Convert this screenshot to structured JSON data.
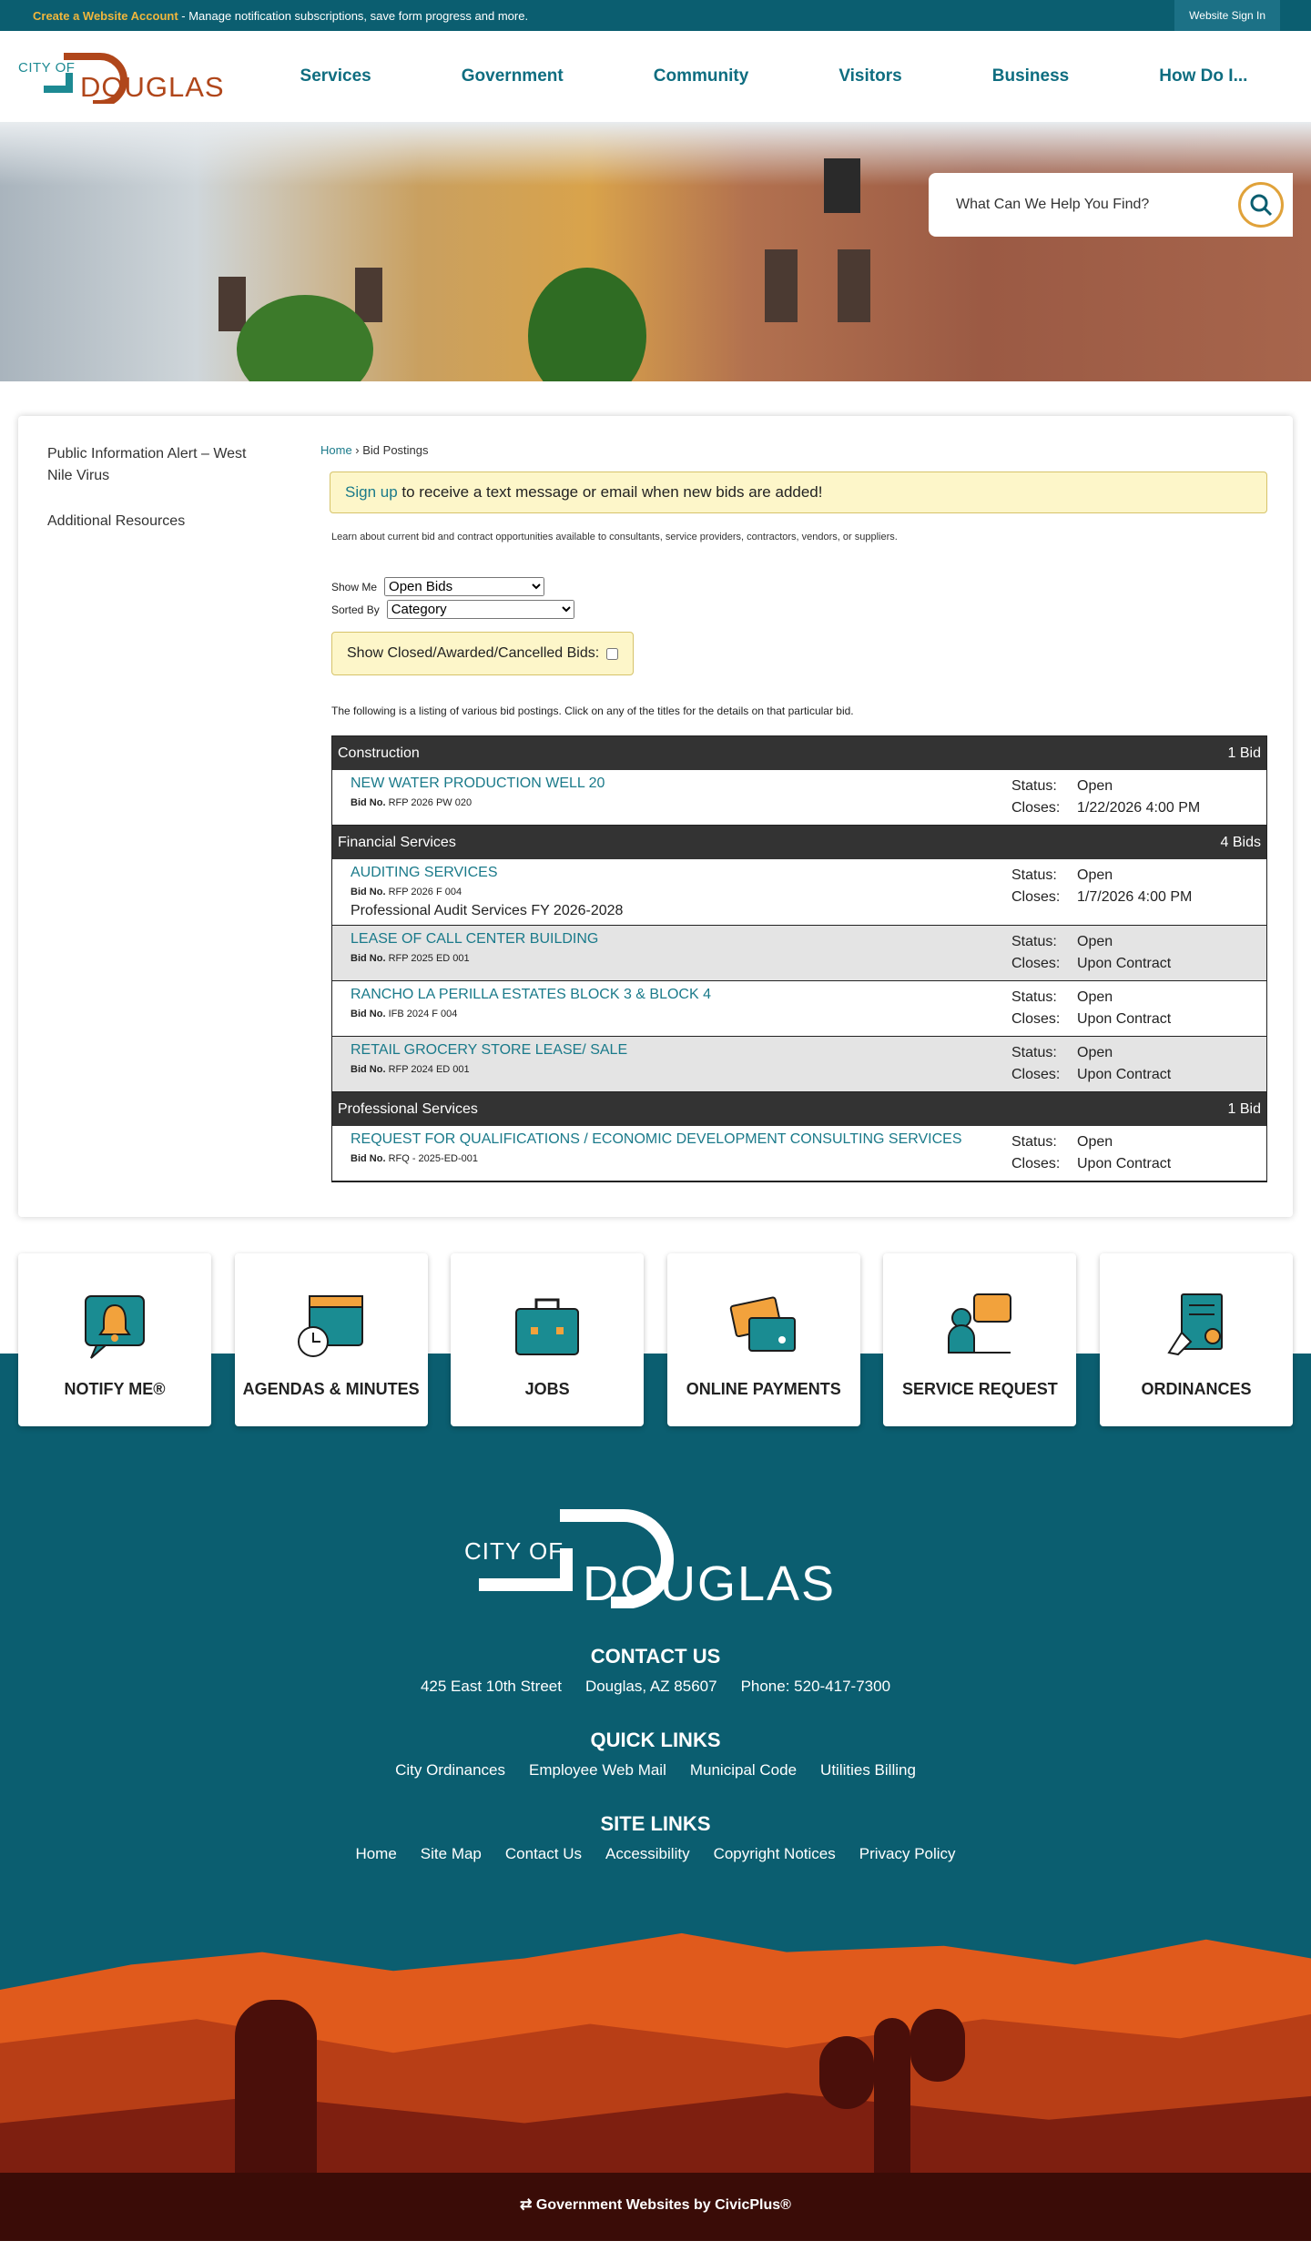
{
  "topbar": {
    "create_link": "Create a Website Account",
    "create_text": " - Manage notification subscriptions, save form progress and more.",
    "signin": "Website Sign In"
  },
  "logo": {
    "cityof": "CITY OF",
    "name": "DOUGLAS"
  },
  "nav": [
    "Services",
    "Government",
    "Community",
    "Visitors",
    "Business",
    "How Do I..."
  ],
  "search": {
    "placeholder": "What Can We Help You Find?"
  },
  "sidebar": [
    "Public Information Alert – West Nile Virus",
    "Additional Resources"
  ],
  "breadcrumb": {
    "home": "Home",
    "current": "Bid Postings"
  },
  "signup": {
    "link": "Sign up",
    "text": " to receive a text message or email when new bids are added!"
  },
  "intro": "Learn about current bid and contract opportunities available to consultants, service providers, contractors, vendors, or suppliers.",
  "filters": {
    "show_me_label": "Show Me",
    "show_me_value": "Open Bids",
    "sorted_by_label": "Sorted By",
    "sorted_by_value": "Category",
    "closed_label": "Show Closed/Awarded/Cancelled Bids:"
  },
  "listing_note": "The following is a listing of various bid postings. Click on any of the titles for the details on that particular bid.",
  "labels": {
    "bid_no": "Bid No.",
    "status": "Status:",
    "closes": "Closes:"
  },
  "categories": [
    {
      "name": "Construction",
      "count": "1 Bid",
      "bids": [
        {
          "title": "NEW WATER PRODUCTION WELL 20",
          "bid_no": "RFP 2026 PW 020",
          "desc": "",
          "status": "Open",
          "closes": "1/22/2026 4:00 PM"
        }
      ]
    },
    {
      "name": "Financial Services",
      "count": "4 Bids",
      "bids": [
        {
          "title": "AUDITING SERVICES",
          "bid_no": "RFP 2026 F 004",
          "desc": "Professional Audit Services FY 2026-2028",
          "status": "Open",
          "closes": "1/7/2026 4:00 PM"
        },
        {
          "title": "LEASE OF CALL CENTER BUILDING",
          "bid_no": "RFP 2025 ED 001",
          "desc": "",
          "status": "Open",
          "closes": "Upon Contract"
        },
        {
          "title": "RANCHO LA PERILLA ESTATES BLOCK 3 & BLOCK 4",
          "bid_no": "IFB 2024 F 004",
          "desc": "",
          "status": "Open",
          "closes": "Upon Contract"
        },
        {
          "title": "RETAIL GROCERY STORE LEASE/ SALE",
          "bid_no": "RFP 2024 ED 001",
          "desc": "",
          "status": "Open",
          "closes": "Upon Contract"
        }
      ]
    },
    {
      "name": "Professional Services",
      "count": "1 Bid",
      "bids": [
        {
          "title": "REQUEST FOR QUALIFICATIONS / ECONOMIC DEVELOPMENT CONSULTING SERVICES",
          "bid_no": "RFQ - 2025-ED-001",
          "desc": "",
          "status": "Open",
          "closes": "Upon Contract"
        }
      ]
    }
  ],
  "quick_links": [
    {
      "label": "NOTIFY ME®",
      "icon": "bell-icon"
    },
    {
      "label": "AGENDAS & MINUTES",
      "icon": "calendar-clock-icon"
    },
    {
      "label": "JOBS",
      "icon": "briefcase-icon"
    },
    {
      "label": "ONLINE PAYMENTS",
      "icon": "credit-card-icon"
    },
    {
      "label": "SERVICE REQUEST",
      "icon": "chat-person-icon"
    },
    {
      "label": "ORDINANCES",
      "icon": "document-seal-icon"
    }
  ],
  "footer": {
    "contact_title": "CONTACT US",
    "contact": [
      "425 East 10th Street",
      "Douglas, AZ 85607",
      "Phone: 520-417-7300"
    ],
    "quick_title": "QUICK LINKS",
    "quick": [
      "City Ordinances",
      "Employee Web Mail",
      "Municipal Code",
      "Utilities Billing"
    ],
    "site_title": "SITE LINKS",
    "site": [
      "Home",
      "Site Map",
      "Contact Us",
      "Accessibility",
      "Copyright Notices",
      "Privacy Policy"
    ],
    "credits": "Government Websites by CivicPlus®"
  },
  "colors": {
    "teal": "#0b5e70",
    "accent": "#e0a23a",
    "brand_orange": "#b0461a"
  }
}
